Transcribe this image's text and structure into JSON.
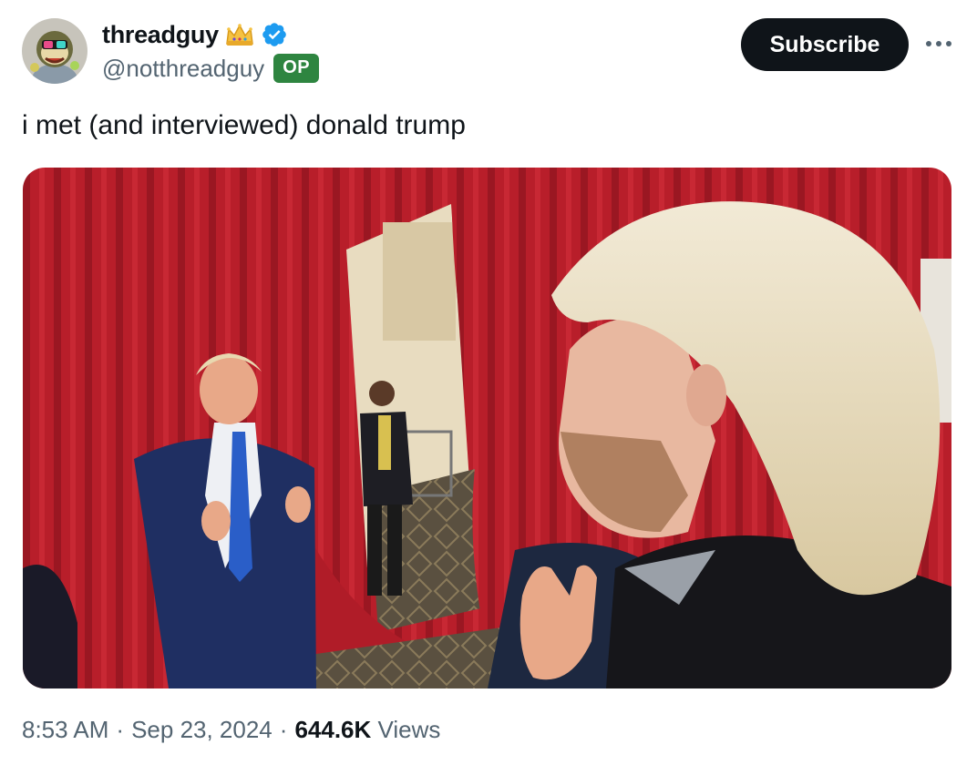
{
  "author": {
    "display_name": "threadguy",
    "handle": "@notthreadguy",
    "op_badge": "OP",
    "avatar_icon": "cartoon-avatar",
    "crown_icon": "crown-icon",
    "verified_icon": "verified-badge-icon",
    "verified_color": "#1d9bf0",
    "op_color": "#2e8540"
  },
  "actions": {
    "subscribe_label": "Subscribe",
    "more_icon": "more-dots-icon"
  },
  "tweet": {
    "text": "i met (and interviewed) donald trump"
  },
  "meta": {
    "time": "8:53 AM",
    "separator1": "·",
    "date": "Sep 23, 2024",
    "separator2": "·",
    "views_count": "644.6K",
    "views_label": "Views"
  },
  "colors": {
    "text_primary": "#0f1419",
    "text_secondary": "#536471",
    "button_bg": "#0f1419"
  }
}
